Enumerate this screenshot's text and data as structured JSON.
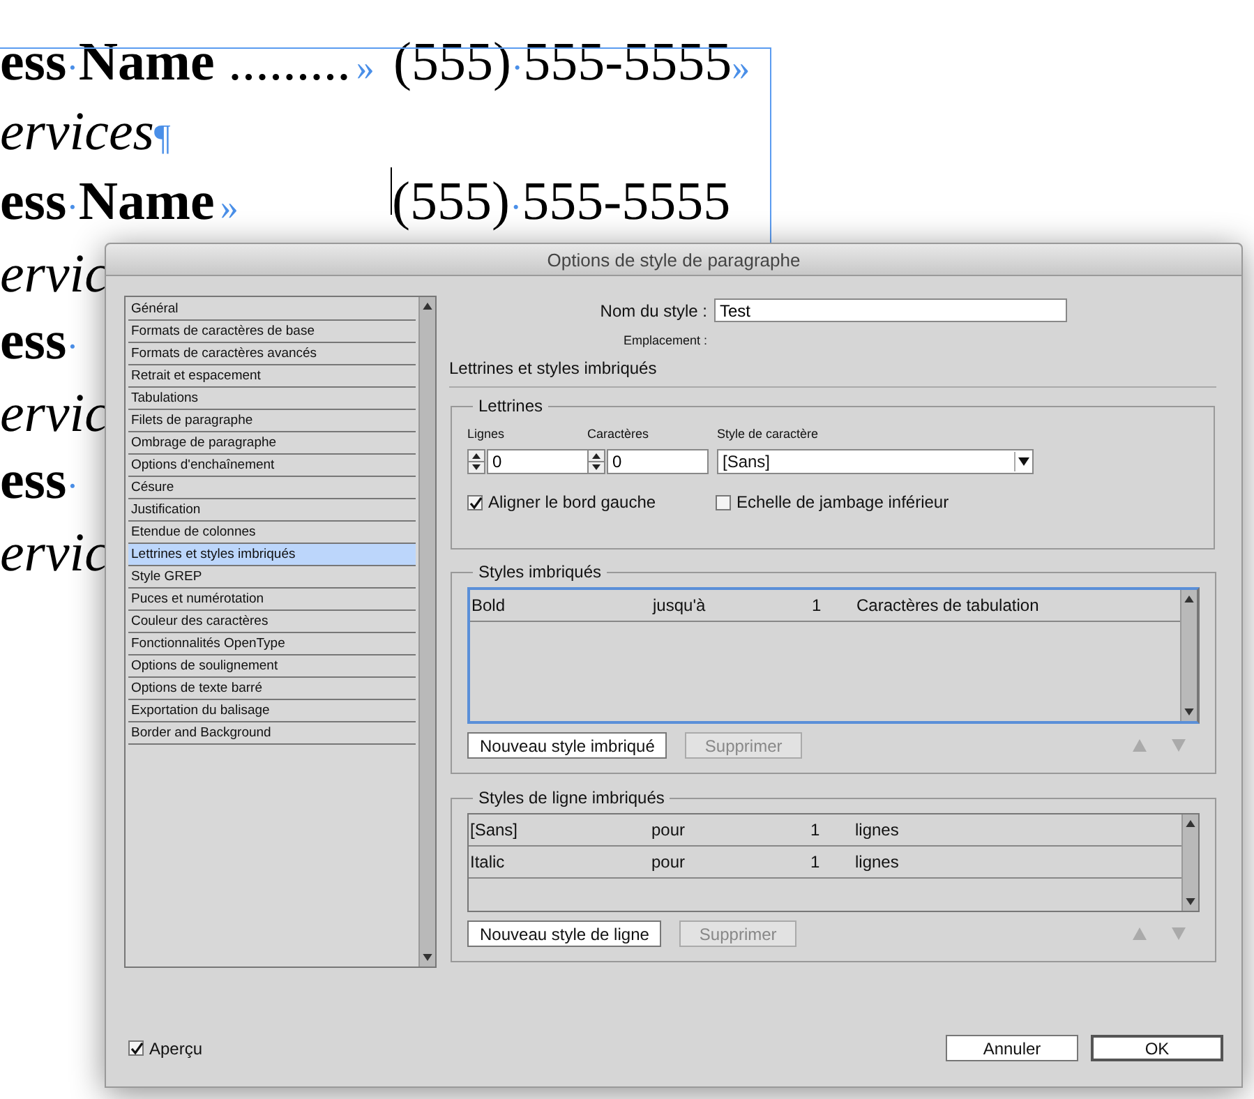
{
  "document": {
    "lines": [
      {
        "cursor": false,
        "left": [
          {
            "kind": "bold",
            "text": "ess"
          },
          {
            "kind": "mark",
            "text": "·"
          },
          {
            "kind": "bold",
            "text": "Name"
          },
          {
            "kind": "regular",
            "text": " ........."
          },
          {
            "kind": "tab",
            "text": "»"
          }
        ],
        "right": [
          {
            "kind": "regular",
            "text": "(555)"
          },
          {
            "kind": "mark",
            "text": "·"
          },
          {
            "kind": "regular",
            "text": "555-5555"
          },
          {
            "kind": "mark",
            "text": "»"
          }
        ]
      },
      {
        "cursor": false,
        "left": [
          {
            "kind": "italic",
            "text": "ervices"
          },
          {
            "kind": "mark",
            "text": "¶"
          }
        ]
      },
      {
        "cursor": true,
        "left": [
          {
            "kind": "bold",
            "text": "ess"
          },
          {
            "kind": "mark",
            "text": "·"
          },
          {
            "kind": "bold",
            "text": "Name"
          },
          {
            "kind": "tab",
            "text": "»"
          }
        ],
        "right": [
          {
            "kind": "regular",
            "text": "(555)"
          },
          {
            "kind": "mark",
            "text": "·"
          },
          {
            "kind": "regular",
            "text": "555-5555"
          }
        ]
      },
      {
        "cursor": false,
        "left": [
          {
            "kind": "italic",
            "text": "ervic"
          }
        ]
      },
      {
        "cursor": false,
        "left": [
          {
            "kind": "bold",
            "text": "ess"
          },
          {
            "kind": "mark",
            "text": "·"
          }
        ]
      },
      {
        "cursor": false,
        "left": [
          {
            "kind": "italic",
            "text": "ervic"
          }
        ]
      },
      {
        "cursor": false,
        "left": [
          {
            "kind": "bold",
            "text": "ess"
          },
          {
            "kind": "mark",
            "text": "·"
          }
        ]
      },
      {
        "cursor": false,
        "left": [
          {
            "kind": "italic",
            "text": "ervic"
          }
        ]
      }
    ]
  },
  "dialog": {
    "title": "Options de style de paragraphe",
    "categories": [
      {
        "label": "Général",
        "selected": false
      },
      {
        "label": "Formats de caractères de base",
        "selected": false
      },
      {
        "label": "Formats de caractères avancés",
        "selected": false
      },
      {
        "label": "Retrait et espacement",
        "selected": false
      },
      {
        "label": "Tabulations",
        "selected": false
      },
      {
        "label": "Filets de paragraphe",
        "selected": false
      },
      {
        "label": "Ombrage de paragraphe",
        "selected": false
      },
      {
        "label": "Options d'enchaînement",
        "selected": false
      },
      {
        "label": "Césure",
        "selected": false
      },
      {
        "label": "Justification",
        "selected": false
      },
      {
        "label": "Etendue de colonnes",
        "selected": false
      },
      {
        "label": "Lettrines et styles imbriqués",
        "selected": true
      },
      {
        "label": "Style GREP",
        "selected": false
      },
      {
        "label": "Puces et numérotation",
        "selected": false
      },
      {
        "label": "Couleur des caractères",
        "selected": false
      },
      {
        "label": "Fonctionnalités OpenType",
        "selected": false
      },
      {
        "label": "Options de soulignement",
        "selected": false
      },
      {
        "label": "Options de texte barré",
        "selected": false
      },
      {
        "label": "Exportation du balisage",
        "selected": false
      },
      {
        "label": "Border and Background",
        "selected": false
      }
    ],
    "style_name": {
      "label": "Nom du style :",
      "value": "Test"
    },
    "location_label": "Emplacement :",
    "section_title": "Lettrines et styles imbriqués",
    "drop_caps": {
      "title": "Lettrines",
      "lines": {
        "label": "Lignes",
        "value": "0"
      },
      "characters": {
        "label": "Caractères",
        "value": "0"
      },
      "char_style": {
        "label": "Style de caractère",
        "value": "[Sans]"
      },
      "checkboxes": [
        {
          "label": "Aligner le bord gauche",
          "checked": true
        },
        {
          "label": "Echelle de jambage inférieur",
          "checked": false
        }
      ]
    },
    "nested_styles": {
      "title": "Styles imbriqués",
      "rows": [
        [
          "Bold",
          "jusqu'à",
          "1",
          "Caractères de tabulation"
        ]
      ],
      "buttons": [
        {
          "label": "Nouveau style imbriqué",
          "disabled": false
        },
        {
          "label": "Supprimer",
          "disabled": true
        }
      ]
    },
    "line_styles": {
      "title": "Styles de ligne imbriqués",
      "rows": [
        [
          "[Sans]",
          "pour",
          "1",
          "lignes"
        ],
        [
          "Italic",
          "pour",
          "1",
          "lignes"
        ]
      ],
      "buttons": [
        {
          "label": "Nouveau style de ligne",
          "disabled": false
        },
        {
          "label": "Supprimer",
          "disabled": true
        }
      ]
    },
    "preview": {
      "label": "Aperçu",
      "checked": true
    },
    "buttons": [
      {
        "label": "Annuler",
        "kind": "normal"
      },
      {
        "label": "OK",
        "kind": "default"
      }
    ]
  }
}
